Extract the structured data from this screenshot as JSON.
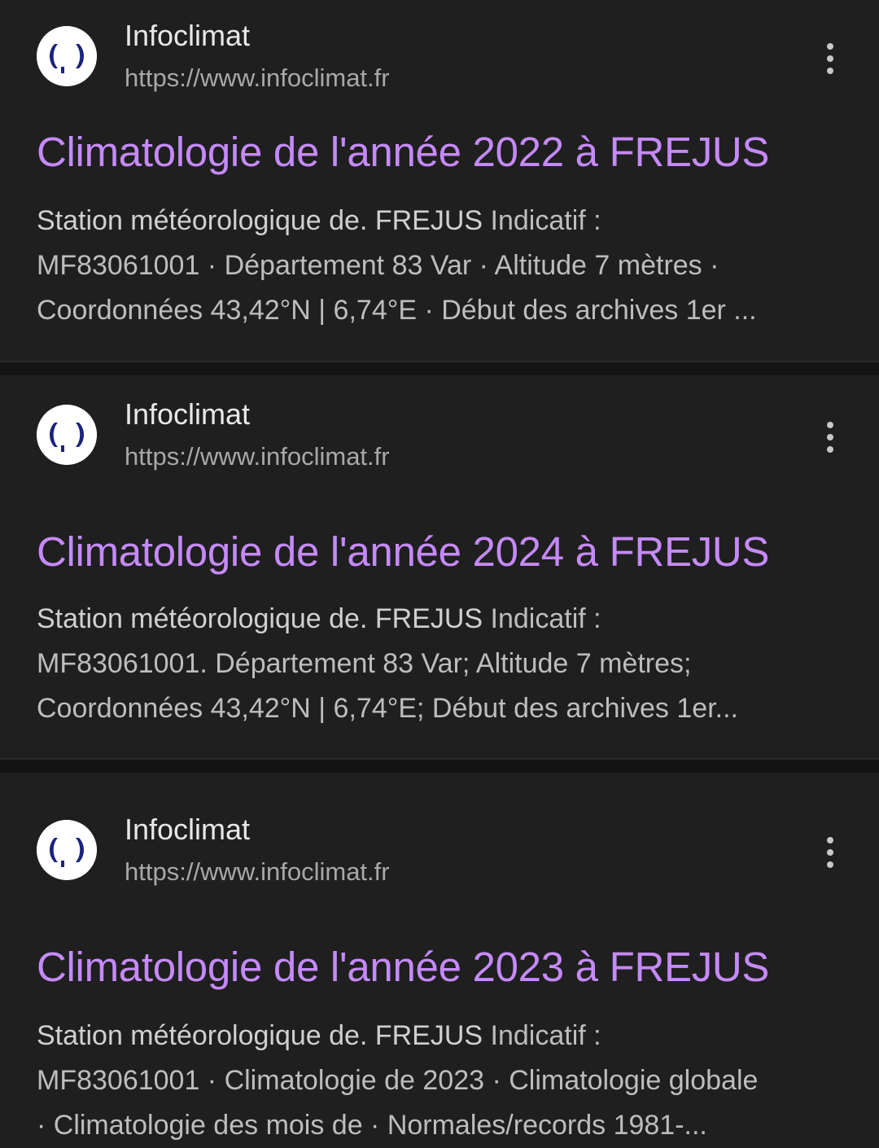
{
  "results": [
    {
      "site_name": "Infoclimat",
      "url": "https://www.infoclimat.fr",
      "title": "Climatologie de l'année 2022 à FREJUS",
      "snippet_lines": [
        {
          "strong": "Station météorologique de. FREJUS",
          "rest": " Indicatif :"
        },
        {
          "strong": "",
          "rest": "MF83061001 · Département 83 Var · Altitude 7 mètres ·"
        },
        {
          "strong": "",
          "rest": "Coordonnées 43,42°N | 6,74°E · Début des archives 1er ..."
        }
      ]
    },
    {
      "site_name": "Infoclimat",
      "url": "https://www.infoclimat.fr",
      "title": "Climatologie de l'année 2024 à FREJUS",
      "snippet_lines": [
        {
          "strong": "Station météorologique de. FREJUS",
          "rest": " Indicatif :"
        },
        {
          "strong": "",
          "rest": "MF83061001. Département 83 Var; Altitude 7 mètres;"
        },
        {
          "strong": "",
          "rest": "Coordonnées 43,42°N | 6,74°E; Début des archives 1er..."
        }
      ]
    },
    {
      "site_name": "Infoclimat",
      "url": "https://www.infoclimat.fr",
      "title": "Climatologie de l'année 2023 à FREJUS",
      "snippet_lines": [
        {
          "strong": "Station météorologique de. FREJUS",
          "rest": " Indicatif :"
        },
        {
          "strong": "",
          "rest": "MF83061001 · Climatologie de 2023 · Climatologie globale"
        },
        {
          "strong": "",
          "rest": "· Climatologie des mois de · Normales/records 1981-..."
        }
      ]
    }
  ],
  "icons": {
    "favicon": "infoclimat-logo-icon",
    "menu": "more-vert-icon"
  },
  "colors": {
    "background": "#1f1f1f",
    "title_link": "#c58af9",
    "logo_blue": "#1a237e"
  }
}
